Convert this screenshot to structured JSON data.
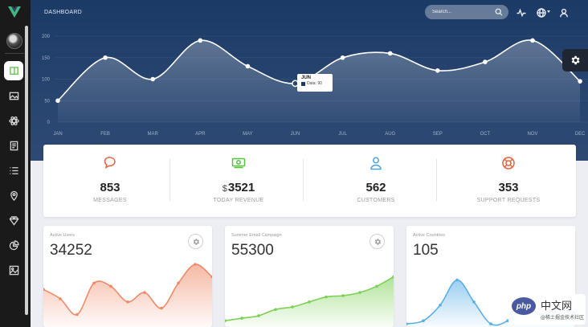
{
  "header": {
    "title": "DASHBOARD",
    "search_placeholder": "Search...",
    "icons": [
      "pulse-icon",
      "globe-icon",
      "user-icon"
    ]
  },
  "sidebar": {
    "items": [
      {
        "icon": "book-icon",
        "active": true
      },
      {
        "icon": "image-icon",
        "active": false
      },
      {
        "icon": "atom-icon",
        "active": false
      },
      {
        "icon": "document-icon",
        "active": false
      },
      {
        "icon": "list-icon",
        "active": false
      },
      {
        "icon": "location-pin-icon",
        "active": false
      },
      {
        "icon": "diamond-icon",
        "active": false
      },
      {
        "icon": "pie-chart-icon",
        "active": false
      },
      {
        "icon": "picture-icon",
        "active": false
      }
    ]
  },
  "chart_data": [
    {
      "type": "line",
      "categories": [
        "JAN",
        "FEB",
        "MAR",
        "APR",
        "MAY",
        "JUN",
        "JUL",
        "AUG",
        "SEP",
        "OCT",
        "NOV",
        "DEC"
      ],
      "values": [
        50,
        150,
        100,
        190,
        130,
        90,
        150,
        160,
        120,
        140,
        190,
        95
      ],
      "yticks": [
        "200",
        "150",
        "100",
        "50",
        "0"
      ],
      "ylim": [
        0,
        200
      ],
      "tooltip": {
        "month": "JUN",
        "label": "Data: 90"
      }
    },
    {
      "type": "area",
      "card": "Active Users",
      "values": [
        60,
        45,
        20,
        70,
        65,
        40,
        55,
        30,
        70,
        100,
        80
      ]
    },
    {
      "type": "area",
      "card": "Summer Email Campaign",
      "values": [
        10,
        14,
        18,
        28,
        32,
        40,
        48,
        50,
        55,
        65,
        80
      ]
    },
    {
      "type": "area",
      "card": "Active Countries",
      "values": [
        5,
        10,
        35,
        75,
        40,
        5,
        10,
        35,
        20,
        28,
        22
      ]
    }
  ],
  "stats": [
    {
      "icon": "chat-bubble-icon",
      "color": "#e0613a",
      "prefix": "",
      "value": "853",
      "label": "MESSAGES"
    },
    {
      "icon": "money-icon",
      "color": "#57c13c",
      "prefix": "$",
      "value": "3521",
      "label": "TODAY REVENUE"
    },
    {
      "icon": "customer-icon",
      "color": "#4aa3df",
      "prefix": "",
      "value": "562",
      "label": "CUSTOMERS"
    },
    {
      "icon": "lifebuoy-icon",
      "color": "#e0613a",
      "prefix": "",
      "value": "353",
      "label": "SUPPORT REQUESTS"
    }
  ],
  "cards": [
    {
      "title": "Active Users",
      "value": "34252",
      "color": "#ef8a68"
    },
    {
      "title": "Summer Email Campaign",
      "value": "55300",
      "color": "#7dd056"
    },
    {
      "title": "Active Countries",
      "value": "105",
      "color": "#5aaee8"
    }
  ],
  "watermark": {
    "logo": "php",
    "cn": "中文网",
    "sub": "@稀土掘金技术社区"
  }
}
